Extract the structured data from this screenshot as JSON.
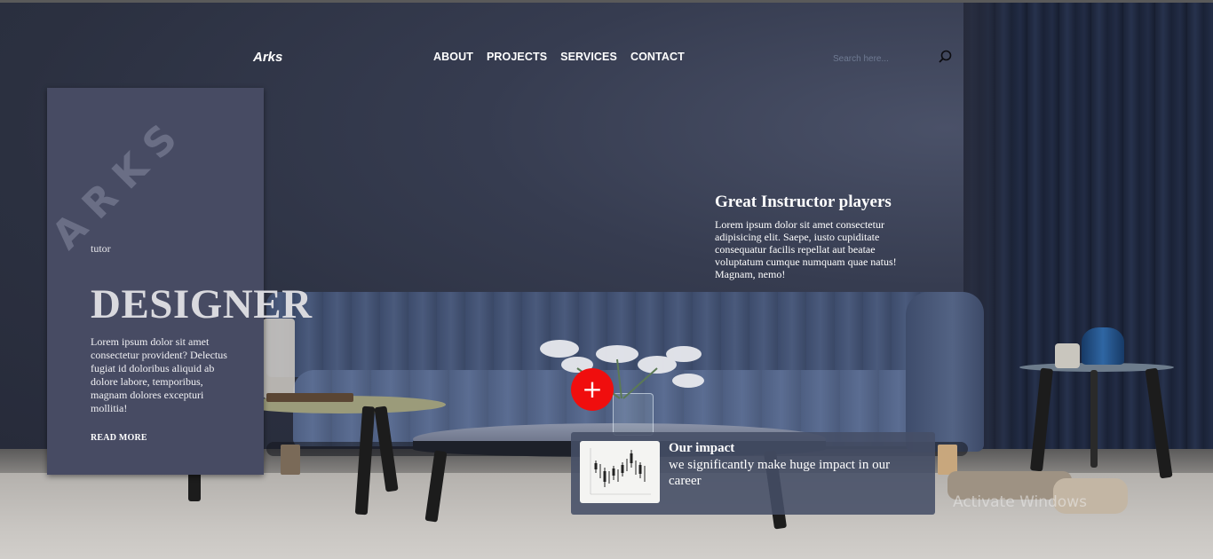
{
  "nav": {
    "brand": "Arks",
    "links": [
      "ABOUT",
      "PROJECTS",
      "SERVICES",
      "CONTACT"
    ],
    "search_placeholder": "Search here..."
  },
  "card": {
    "watermark": "ARKS",
    "kicker": "tutor",
    "title": "DESIGNER",
    "body": "Lorem ipsum dolor sit amet consectetur provident? Delectus fugiat id doloribus aliquid ab dolore labore, temporibus, magnam dolores excepturi mollitia!",
    "read_more": "READ MORE"
  },
  "info": {
    "title": "Great Instructor players",
    "body": "Lorem ipsum dolor sit amet consectetur adipisicing elit. Saepe, iusto cupiditate consequatur facilis repellat aut beatae voluptatum cumque numquam quae natus! Magnam, nemo!"
  },
  "plus_button": "+",
  "impact": {
    "title": "Our impact",
    "body": "we significantly make huge impact in our career"
  },
  "os_watermark": "Activate Windows",
  "colors": {
    "accent_red": "#f00e0e",
    "card_bg": "#474b63",
    "wall": "#2d3344"
  },
  "icons": {
    "search": "search-icon",
    "plus": "plus-icon"
  }
}
